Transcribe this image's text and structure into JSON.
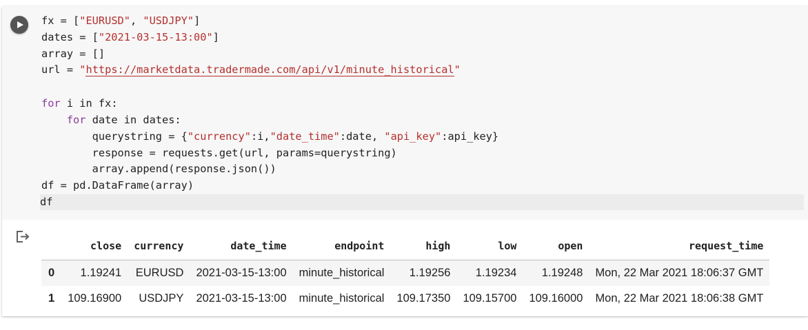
{
  "code_lines": [
    [
      {
        "t": "fx = [",
        "c": ""
      },
      {
        "t": "\"EURUSD\"",
        "c": "str"
      },
      {
        "t": ", ",
        "c": ""
      },
      {
        "t": "\"USDJPY\"",
        "c": "str"
      },
      {
        "t": "]",
        "c": ""
      }
    ],
    [
      {
        "t": "dates = [",
        "c": ""
      },
      {
        "t": "\"2021-03-15-13:00\"",
        "c": "str"
      },
      {
        "t": "]",
        "c": ""
      }
    ],
    [
      {
        "t": "array = []",
        "c": ""
      }
    ],
    [
      {
        "t": "url = ",
        "c": ""
      },
      {
        "t": "\"",
        "c": "str"
      },
      {
        "t": "https://marketdata.tradermade.com/api/v1/minute_historical",
        "c": "url"
      },
      {
        "t": "\"",
        "c": "str"
      }
    ],
    [],
    [
      {
        "t": "for",
        "c": "kw"
      },
      {
        "t": " i ",
        "c": ""
      },
      {
        "t": "in",
        "c": ""
      },
      {
        "t": " fx:",
        "c": ""
      }
    ],
    [
      {
        "t": "    ",
        "c": ""
      },
      {
        "t": "for",
        "c": "kw"
      },
      {
        "t": " date ",
        "c": ""
      },
      {
        "t": "in",
        "c": ""
      },
      {
        "t": " dates:",
        "c": ""
      }
    ],
    [
      {
        "t": "        querystring = {",
        "c": ""
      },
      {
        "t": "\"currency\"",
        "c": "str"
      },
      {
        "t": ":i,",
        "c": ""
      },
      {
        "t": "\"date_time\"",
        "c": "str"
      },
      {
        "t": ":date, ",
        "c": ""
      },
      {
        "t": "\"api_key\"",
        "c": "str"
      },
      {
        "t": ":api_key}",
        "c": ""
      }
    ],
    [
      {
        "t": "        response = requests.get(url, params=querystring)",
        "c": ""
      }
    ],
    [
      {
        "t": "        array.append(response.json())",
        "c": ""
      }
    ],
    [
      {
        "t": "df = pd.DataFrame(array)",
        "c": ""
      }
    ],
    [
      {
        "t": "df",
        "c": ""
      }
    ]
  ],
  "table": {
    "columns": [
      "",
      "close",
      "currency",
      "date_time",
      "endpoint",
      "high",
      "low",
      "open",
      "request_time"
    ],
    "rows": [
      [
        "0",
        "1.19241",
        "EURUSD",
        "2021-03-15-13:00",
        "minute_historical",
        "1.19256",
        "1.19234",
        "1.19248",
        "Mon, 22 Mar 2021 18:06:37 GMT"
      ],
      [
        "1",
        "109.16900",
        "USDJPY",
        "2021-03-15-13:00",
        "minute_historical",
        "109.17350",
        "109.15700",
        "109.16000",
        "Mon, 22 Mar 2021 18:06:38 GMT"
      ]
    ]
  },
  "icons": {
    "run": "play-icon",
    "output": "output-arrow-icon"
  },
  "colors": {
    "keyword": "#8b3d9b",
    "string": "#b4302e",
    "code_bg": "#f7f7f7",
    "run_button": "#555555"
  }
}
